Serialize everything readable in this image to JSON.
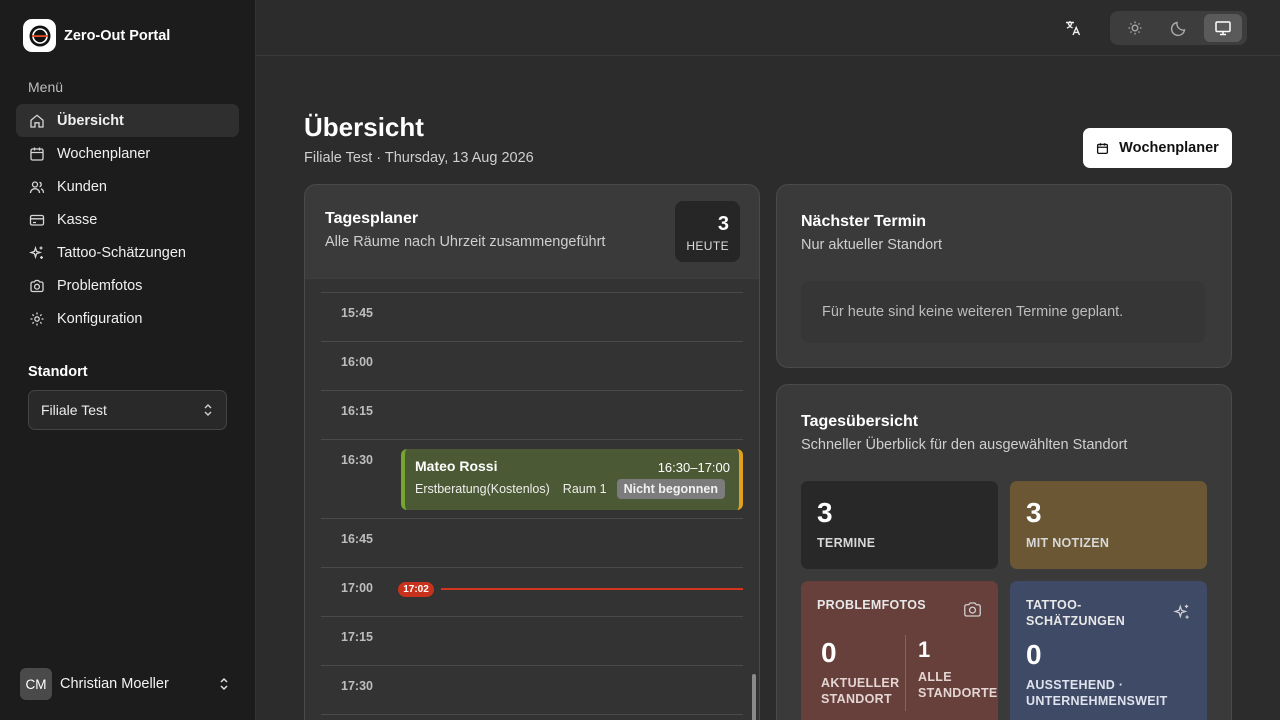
{
  "app": {
    "name": "Zero-Out Portal"
  },
  "sidebar": {
    "menu_label": "Menü",
    "items": [
      {
        "label": "Übersicht",
        "icon": "home-icon",
        "active": true
      },
      {
        "label": "Wochenplaner",
        "icon": "calendar-icon"
      },
      {
        "label": "Kunden",
        "icon": "users-icon"
      },
      {
        "label": "Kasse",
        "icon": "credit-card-icon"
      },
      {
        "label": "Tattoo-Schätzungen",
        "icon": "sparkles-icon"
      },
      {
        "label": "Problemfotos",
        "icon": "camera-icon"
      },
      {
        "label": "Konfiguration",
        "icon": "gear-icon"
      }
    ],
    "location_label": "Standort",
    "location_value": "Filiale Test",
    "user": {
      "initials": "CM",
      "name": "Christian Moeller"
    }
  },
  "topbar": {
    "language_icon": "translate-icon",
    "theme_options": [
      "sun-icon",
      "moon-icon",
      "monitor-icon"
    ],
    "theme_active": "monitor-icon"
  },
  "header": {
    "title": "Übersicht",
    "subtitle": "Filiale Test · Thursday, 13 Aug 2026",
    "week_button": "Wochenplaner"
  },
  "planner": {
    "title": "Tagesplaner",
    "subtitle": "Alle Räume nach Uhrzeit zusammengeführt",
    "count": "3",
    "count_label": "HEUTE",
    "slots": [
      "15:45",
      "16:00",
      "16:15",
      "16:30",
      "16:45",
      "17:00",
      "17:15",
      "17:30"
    ],
    "now": "17:02",
    "appointment": {
      "name": "Mateo Rossi",
      "time": "16:30–17:00",
      "service": "Erstberatung(Kostenlos)",
      "room": "Raum 1",
      "status": "Nicht begonnen"
    }
  },
  "next": {
    "title": "Nächster Termin",
    "subtitle": "Nur aktueller Standort",
    "empty": "Für heute sind keine weiteren Termine geplant."
  },
  "today": {
    "title": "Tagesübersicht",
    "subtitle": "Schneller Überblick für den ausgewählten Standort",
    "termine": {
      "value": "3",
      "label": "TERMINE"
    },
    "notizen": {
      "value": "3",
      "label": "MIT NOTIZEN"
    },
    "problemfotos": {
      "label": "PROBLEMFOTOS",
      "current_value": "0",
      "current_label_1": "AKTUELLER",
      "current_label_2": "STANDORT",
      "all_value": "1",
      "all_label_1": "ALLE",
      "all_label_2": "STANDORTE"
    },
    "tattoo": {
      "label_1": "TATTOO-",
      "label_2": "SCHÄTZUNGEN",
      "value": "0",
      "sub_1": "AUSSTEHEND ·",
      "sub_2": "UNTERNEHMENSWEIT"
    }
  }
}
